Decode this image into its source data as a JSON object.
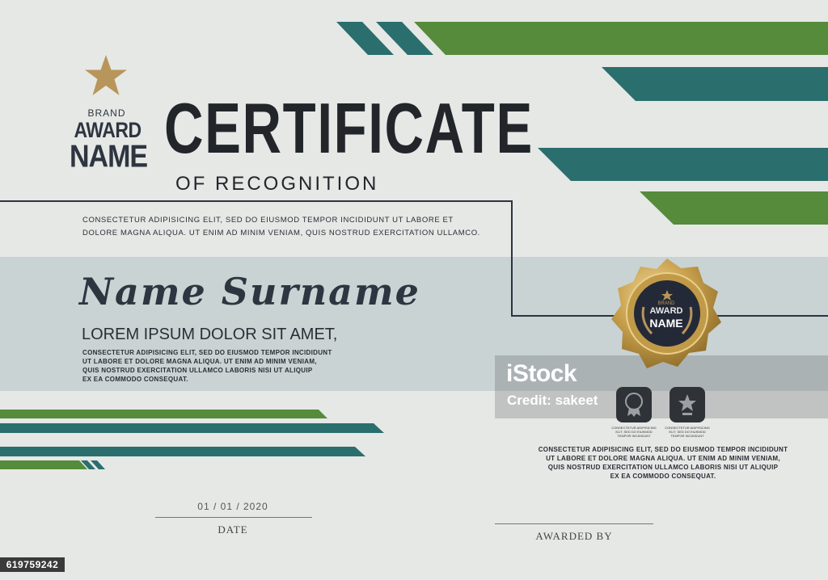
{
  "brand": {
    "small": "BRAND",
    "award": "AWARD",
    "name": "NAME"
  },
  "certificate": {
    "title": "CERTIFICATE",
    "subtitle": "OF RECOGNITION",
    "intro_line1": "CONSECTETUR ADIPISICING ELIT, SED DO EIUSMOD TEMPOR INCIDIDUNT UT LABORE ET",
    "intro_line2": "DOLORE MAGNA ALIQUA. UT ENIM AD MINIM VENIAM, QUIS NOSTRUD EXERCITATION ULLAMCO.",
    "recipient_name": "Name Surname",
    "headline": "LOREM IPSUM DOLOR SIT AMET,",
    "body_line1": "CONSECTETUR ADIPISICING ELIT, SED DO EIUSMOD TEMPOR INCIDIDUNT",
    "body_line2": "UT LABORE ET DOLORE MAGNA ALIQUA. UT ENIM AD MINIM VENIAM,",
    "body_line3": "QUIS NOSTRUD EXERCITATION ULLAMCO LABORIS NISI UT ALIQUIP",
    "body_line4": "EX EA COMMODO CONSEQUAT."
  },
  "seal": {
    "brand": "BRAND",
    "award": "AWARD",
    "name": "NAME"
  },
  "right_text": {
    "line1": "CONSECTETUR ADIPISICING ELIT, SED DO EIUSMOD TEMPOR INCIDIDUNT",
    "line2": "UT LABORE ET DOLORE MAGNA ALIQUA. UT ENIM AD MINIM VENIAM,",
    "line3": "QUIS NOSTRUD EXERCITATION ULLAMCO LABORIS NISI UT ALIQUIP",
    "line4": "EX EA COMMODO CONSEQUAT."
  },
  "signatures": {
    "date_value": "01 / 01 / 2020",
    "date_label": "DATE",
    "awarded_label": "AWARDED BY"
  },
  "watermark": {
    "logo": "iStock",
    "credit": "Credit: sakeet",
    "stamp_caption_1": "CONSECTETUR ADIPISICING ELIT, SED DO EIUSMOD TEMPOR INCIDIDUNT",
    "stamp_caption_2": "CONSECTETUR ADIPISICING ELIT, SED DO EIUSMOD TEMPOR INCIDIDUNT"
  },
  "image_id": "619759242",
  "colors": {
    "green": "#558b3a",
    "teal": "#2b6e6e",
    "gold": "#b8955a",
    "dark": "#2d3540",
    "band": "#c9d3d4"
  }
}
